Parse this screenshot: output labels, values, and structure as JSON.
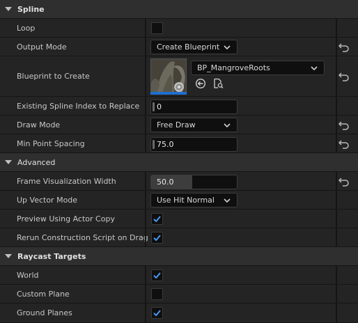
{
  "sections": {
    "spline": "Spline",
    "advanced": "Advanced",
    "raycast": "Raycast Targets"
  },
  "rows": {
    "loop": {
      "label": "Loop",
      "checked": false
    },
    "output_mode": {
      "label": "Output Mode",
      "value": "Create Blueprint"
    },
    "blueprint_to_create": {
      "label": "Blueprint to Create",
      "value": "BP_MangroveRoots"
    },
    "existing_index": {
      "label": "Existing Spline Index to Replace",
      "value": "0"
    },
    "draw_mode": {
      "label": "Draw Mode",
      "value": "Free Draw"
    },
    "min_point_spacing": {
      "label": "Min Point Spacing",
      "value": "75.0"
    },
    "frame_vis_width": {
      "label": "Frame Visualization Width",
      "value": "50.0",
      "fill_fraction": 0.48
    },
    "up_vector_mode": {
      "label": "Up Vector Mode",
      "value": "Use Hit Normal"
    },
    "preview_actor_copy": {
      "label": "Preview Using Actor Copy",
      "checked": true
    },
    "rerun_construction": {
      "label": "Rerun Construction Script on Drag",
      "checked": true
    },
    "world": {
      "label": "World",
      "checked": true
    },
    "custom_plane": {
      "label": "Custom Plane",
      "checked": false
    },
    "ground_planes": {
      "label": "Ground Planes",
      "checked": true
    }
  },
  "icons": {
    "reset": "reset-arrow-icon",
    "use_selected": "use-selected-arrow-icon",
    "browse": "browse-asset-icon",
    "checkmark": "checkmark-icon",
    "chevron": "chevron-down-icon",
    "caret": "section-caret-icon"
  },
  "colors": {
    "accent": "#1f6fd0",
    "check": "#4a9eff",
    "header_bg": "#2f2f2f",
    "row_bg": "#242424",
    "field_bg": "#0f0f0f"
  }
}
